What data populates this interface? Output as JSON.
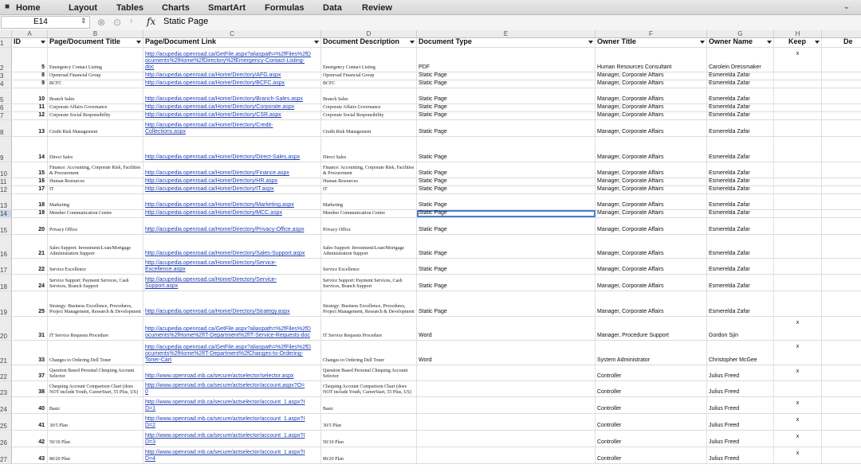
{
  "ribbon": {
    "home_icon": "home-icon",
    "tabs": [
      "Home",
      "Layout",
      "Tables",
      "Charts",
      "SmartArt",
      "Formulas",
      "Data",
      "Review"
    ],
    "collapse_icon": "chevron-down-icon"
  },
  "formula_bar": {
    "name_box": "E14",
    "fx_label": "fx",
    "content": "Static Page"
  },
  "columns": [
    "A",
    "B",
    "C",
    "D",
    "E",
    "F",
    "G",
    "H"
  ],
  "headers": {
    "row_number": "1",
    "id": "ID",
    "title": "Page/Document Title",
    "link": "Page/Document Link",
    "description": "Document Description",
    "type": "Document Type",
    "owner_title": "Owner Title",
    "owner_name": "Owner Name",
    "keep": "Keep",
    "overflow": "De"
  },
  "rows": [
    {
      "rn": "2",
      "id": "5",
      "title": "Emergency Contact Listing",
      "link": [
        "http://acupedia.openroad.ca/GetFile.aspx?aliaspath=%2fFiles%2fD",
        "ocuments%2fHome%2fDirectory%2fEmergency-Contact-Listing-",
        "doc"
      ],
      "desc": "Emergency Contact Listing",
      "type": "PDF",
      "owner_title": "Human Resources Consultant",
      "owner_name": "Carolein Dressmaker",
      "keep": "x"
    },
    {
      "rn": "3",
      "id": "8",
      "title": "Openroad Financial Group",
      "link": [
        "http://acupedia.openroad.ca/Home/Directory/AFG.aspx"
      ],
      "desc": "Openroad Financial Group",
      "type": "Static Page",
      "owner_title": "Manager, Corporate Affairs",
      "owner_name": "Esmerelda Zafar",
      "keep": ""
    },
    {
      "rn": "4",
      "id": "9",
      "title": "BCFC",
      "link": [
        "http://acupedia.openroad.ca/Home/Directory/BCFC.aspx"
      ],
      "desc": "BCFC",
      "type": "Static Page",
      "owner_title": "Manager, Corporate Affairs",
      "owner_name": "Esmerelda Zafar",
      "keep": ""
    },
    {
      "rn": "5",
      "id": "10",
      "title": "Branch Sales",
      "link": [
        "http://acupedia.openroad.ca/Home/Directory/Branch-Sales.aspx"
      ],
      "desc": "Branch Sales",
      "type": "Static Page",
      "owner_title": "Manager, Corporate Affairs",
      "owner_name": "Esmerelda Zafar",
      "keep": ""
    },
    {
      "rn": "6",
      "id": "11",
      "title": "Corporate Affairs Governance",
      "link": [
        "http://acupedia.openroad.ca/Home/Directory/Corporate.aspx"
      ],
      "desc": "Corporate Affairs Governance",
      "type": "Static Page",
      "owner_title": "Manager, Corporate Affairs",
      "owner_name": "Esmerelda Zafar",
      "keep": ""
    },
    {
      "rn": "7",
      "id": "12",
      "title": "Corporate Social Responsibility",
      "link": [
        "http://acupedia.openroad.ca/Home/Directory/CSR.aspx"
      ],
      "desc": "Corporate Social Responsibility",
      "type": "Static Page",
      "owner_title": "Manager, Corporate Affairs",
      "owner_name": "Esmerelda Zafar",
      "keep": ""
    },
    {
      "rn": "8",
      "id": "13",
      "title": "Credit Risk Management",
      "link": [
        "http://acupedia.openroad.ca/Home/Directory/Credit-",
        "Collections.aspx"
      ],
      "desc": "Credit Risk Management",
      "type": "Static Page",
      "owner_title": "Manager, Corporate Affairs",
      "owner_name": "Esmerelda Zafar",
      "keep": ""
    },
    {
      "rn": "9",
      "id": "14",
      "title": "Direct Sales",
      "link": [
        "http://acupedia.openroad.ca/Home/Directory/Direct-Sales.aspx"
      ],
      "desc": "Direct Sales",
      "type": "Static Page",
      "owner_title": "Manager, Corporate Affairs",
      "owner_name": "Esmerelda Zafar",
      "keep": ""
    },
    {
      "rn": "10",
      "id": "15",
      "title": "Finance: Accounting, Corporate Risk, Facilities & Procurement",
      "link": [
        "http://acupedia.openroad.ca/Home/Directory/Finance.aspx"
      ],
      "desc": "Finance: Accounting, Corporate Risk, Facilities & Procurement",
      "type": "Static Page",
      "owner_title": "Manager, Corporate Affairs",
      "owner_name": "Esmerelda Zafar",
      "keep": ""
    },
    {
      "rn": "11",
      "id": "16",
      "title": "Human Resources",
      "link": [
        "http://acupedia.openroad.ca/Home/Directory/HR.aspx"
      ],
      "desc": "Human Resources",
      "type": "Static Page",
      "owner_title": "Manager, Corporate Affairs",
      "owner_name": "Esmerelda Zafar",
      "keep": ""
    },
    {
      "rn": "12",
      "id": "17",
      "title": "IT",
      "link": [
        "http://acupedia.openroad.ca/Home/Directory/IT.aspx"
      ],
      "desc": "IT",
      "type": "Static Page",
      "owner_title": "Manager, Corporate Affairs",
      "owner_name": "Esmerelda Zafar",
      "keep": ""
    },
    {
      "rn": "13",
      "id": "18",
      "title": "Marketing",
      "link": [
        "http://acupedia.openroad.ca/Home/Directory/Marketing.aspx"
      ],
      "desc": "Marketing",
      "type": "Static Page",
      "owner_title": "Manager, Corporate Affairs",
      "owner_name": "Esmerelda Zafar",
      "keep": ""
    },
    {
      "rn": "14",
      "id": "19",
      "title": "Member Communication Centre",
      "link": [
        "http://acupedia.openroad.ca/Home/Directory/MCC.aspx"
      ],
      "desc": "Member Communication Centre",
      "type": "Static Page",
      "owner_title": "Manager, Corporate Affairs",
      "owner_name": "Esmerelda Zafar",
      "keep": ""
    },
    {
      "rn": "15",
      "id": "20",
      "title": "Privacy Office",
      "link": [
        "http://acupedia.openroad.ca/Home/Directory/Privacy-Office.aspx"
      ],
      "desc": "Privacy Office",
      "type": "Static Page",
      "owner_title": "Manager, Corporate Affairs",
      "owner_name": "Esmerelda Zafar",
      "keep": ""
    },
    {
      "rn": "16",
      "id": "21",
      "title": "Sales Support: Investment/Loan/Mortgage Administration Support",
      "link": [
        "http://acupedia.openroad.ca/Home/Directory/Sales-Support.aspx"
      ],
      "desc": "Sales Support: Investment/Loan/Mortgage Administration Support",
      "type": "Static Page",
      "owner_title": "Manager, Corporate Affairs",
      "owner_name": "Esmerelda Zafar",
      "keep": ""
    },
    {
      "rn": "17",
      "id": "22",
      "title": "Service Excellence",
      "link": [
        "http://acupedia.openroad.ca/Home/Directory/Service-",
        "Excellence.aspx"
      ],
      "desc": "Service Excellence",
      "type": "Static Page",
      "owner_title": "Manager, Corporate Affairs",
      "owner_name": "Esmerelda Zafar",
      "keep": ""
    },
    {
      "rn": "18",
      "id": "24",
      "title": "Service Support: Payment Services, Cash Services, Branch Support",
      "link": [
        "http://acupedia.openroad.ca/Home/Directory/Service-",
        "Support.aspx"
      ],
      "desc": "Service Support: Payment Services, Cash Services, Branch Support",
      "type": "Static Page",
      "owner_title": "Manager, Corporate Affairs",
      "owner_name": "Esmerelda Zafar",
      "keep": ""
    },
    {
      "rn": "19",
      "id": "25",
      "title": "Strategy: Business Excellence, Procedures, Project Management, Research & Development",
      "link": [
        "http://acupedia.openroad.ca/Home/Directory/Strategy.aspx"
      ],
      "desc": "Strategy: Business Excellence, Procedures, Project Management, Research & Development",
      "type": "Static Page",
      "owner_title": "Manager, Corporate Affairs",
      "owner_name": "Esmerelda Zafar",
      "keep": ""
    },
    {
      "rn": "20",
      "id": "31",
      "title": "IT Service Requests Procedure",
      "link": [
        "http://acupedia.openroad.ca/GetFile.aspx?aliaspath=%2fFiles%2fD",
        "ocuments%2fHome%2fIT-Department%2fIT-Service-Requests-doc"
      ],
      "desc": "IT Service Requests Procedure",
      "type": "Word",
      "owner_title": "Manager, Procedure Support",
      "owner_name": "Gordon Sjin",
      "keep": "x"
    },
    {
      "rn": "21",
      "id": "33",
      "title": "Changes to Ordering Dell Toner",
      "link": [
        "http://acupedia.openroad.ca/GetFile.aspx?aliaspath=%2fFiles%2fD",
        "ocuments%2fHome%2fIT-Department%2fChanges-to-Ordering-",
        "Toner-Cart"
      ],
      "desc": "Changes to Ordering Dell Toner",
      "type": "Word",
      "owner_title": "System Administrator",
      "owner_name": "Christopher McGee",
      "keep": "x"
    },
    {
      "rn": "22",
      "id": "37",
      "title": "Question Based Personal Chequing Account Selector",
      "link": [
        "http://www.openroad.mb.ca/secure/actselector/selector.aspx"
      ],
      "desc": "Question Based Personal Chequing Account Selector",
      "type": "",
      "owner_title": "Controller",
      "owner_name": "Julius Freed",
      "keep": "x"
    },
    {
      "rn": "23",
      "id": "38",
      "title": "Chequing Account Comparison Chart (does NOT include Youth, CareerStart, 55 Plus, US)",
      "link": [
        "http://www.openroad.mb.ca/secure/actselector/account.aspx?O=",
        "0"
      ],
      "desc": "Chequing Account Comparison Chart (does NOT include Youth, CareerStart, 55 Plus, US)",
      "type": "",
      "owner_title": "Controller",
      "owner_name": "Julius Freed",
      "keep": ""
    },
    {
      "rn": "24",
      "id": "40",
      "title": "Basic",
      "link": [
        "http://www.openroad.mb.ca/secure/actselector/account_1.aspx?I",
        "D=1"
      ],
      "desc": "Basic",
      "type": "",
      "owner_title": "Controller",
      "owner_name": "Julius Freed",
      "keep": "x"
    },
    {
      "rn": "25",
      "id": "41",
      "title": "30/5 Plan",
      "link": [
        "http://www.openroad.mb.ca/secure/actselector/account_1.aspx?I",
        "D=2"
      ],
      "desc": "30/5 Plan",
      "type": "",
      "owner_title": "Controller",
      "owner_name": "Julius Freed",
      "keep": "x"
    },
    {
      "rn": "26",
      "id": "42",
      "title": "50/10 Plan",
      "link": [
        "http://www.openroad.mb.ca/secure/actselector/account_1.aspx?I",
        "D=3"
      ],
      "desc": "50/10 Plan",
      "type": "",
      "owner_title": "Controller",
      "owner_name": "Julius Freed",
      "keep": "x"
    },
    {
      "rn": "27",
      "id": "43",
      "title": "80/20 Plan",
      "link": [
        "http://www.openroad.mb.ca/secure/actselector/account_1.aspx?I",
        "D=4"
      ],
      "desc": "80/20 Plan",
      "type": "",
      "owner_title": "Controller",
      "owner_name": "Julius Freed",
      "keep": "x"
    }
  ]
}
